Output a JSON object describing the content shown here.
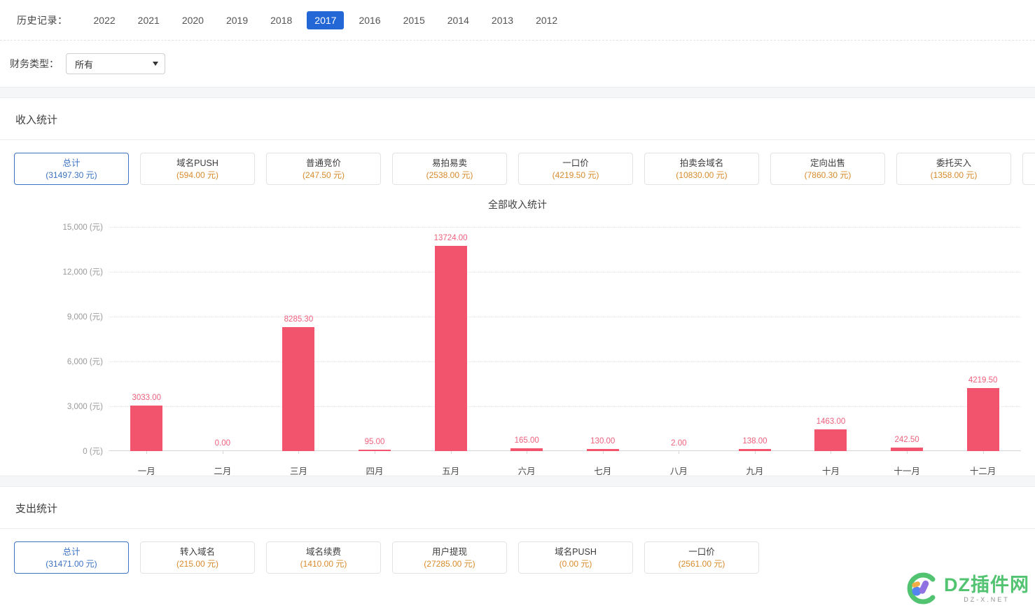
{
  "history": {
    "label": "历史记录：",
    "years": [
      "2022",
      "2021",
      "2020",
      "2019",
      "2018",
      "2017",
      "2016",
      "2015",
      "2014",
      "2013",
      "2012"
    ],
    "active_year": "2017",
    "active_color": "#2366d6"
  },
  "filter": {
    "label": "财务类型：",
    "selected": "所有",
    "options": [
      "所有"
    ]
  },
  "income_section": {
    "title": "收入统计",
    "cards": [
      {
        "name": "总计",
        "value": "(31497.30 元)",
        "active": true
      },
      {
        "name": "域名PUSH",
        "value": "(594.00 元)",
        "active": false
      },
      {
        "name": "普通竞价",
        "value": "(247.50 元)",
        "active": false
      },
      {
        "name": "易拍易卖",
        "value": "(2538.00 元)",
        "active": false
      },
      {
        "name": "一口价",
        "value": "(4219.50 元)",
        "active": false
      },
      {
        "name": "拍卖会域名",
        "value": "(10830.00 元)",
        "active": false
      },
      {
        "name": "定向出售",
        "value": "(7860.30 元)",
        "active": false
      },
      {
        "name": "委托买入",
        "value": "(1358.00 元)",
        "active": false
      },
      {
        "name": "",
        "value": "",
        "active": false
      }
    ]
  },
  "expense_section": {
    "title": "支出统计",
    "cards": [
      {
        "name": "总计",
        "value": "(31471.00 元)",
        "active": true
      },
      {
        "name": "转入域名",
        "value": "(215.00 元)",
        "active": false
      },
      {
        "name": "域名续费",
        "value": "(1410.00 元)",
        "active": false
      },
      {
        "name": "用户提现",
        "value": "(27285.00 元)",
        "active": false
      },
      {
        "name": "域名PUSH",
        "value": "(0.00 元)",
        "active": false
      },
      {
        "name": "一口价",
        "value": "(2561.00 元)",
        "active": false
      }
    ]
  },
  "chart_data": {
    "type": "bar",
    "title": "全部收入统计",
    "xlabel": "",
    "ylabel": "元",
    "ylim": [
      0,
      15000
    ],
    "grid": true,
    "legend": "none",
    "bar_color": "#f2546e",
    "label_color": "#f0607c",
    "y_ticks": [
      "0 (元)",
      "3,000 (元)",
      "6,000 (元)",
      "9,000 (元)",
      "12,000 (元)",
      "15,000 (元)"
    ],
    "y_tick_values": [
      0,
      3000,
      6000,
      9000,
      12000,
      15000
    ],
    "categories": [
      "一月",
      "二月",
      "三月",
      "四月",
      "五月",
      "六月",
      "七月",
      "八月",
      "九月",
      "十月",
      "十一月",
      "十二月"
    ],
    "values": [
      3033.0,
      0.0,
      8285.3,
      95.0,
      13724.0,
      165.0,
      130.0,
      2.0,
      138.0,
      1463.0,
      242.5,
      4219.5
    ],
    "value_labels": [
      "3033.00",
      "0.00",
      "8285.30",
      "95.00",
      "13724.00",
      "165.00",
      "130.00",
      "2.00",
      "138.00",
      "1463.00",
      "242.50",
      "4219.50"
    ]
  },
  "watermark": {
    "main": "DZ插件网",
    "sub": "DZ-X.NET"
  }
}
